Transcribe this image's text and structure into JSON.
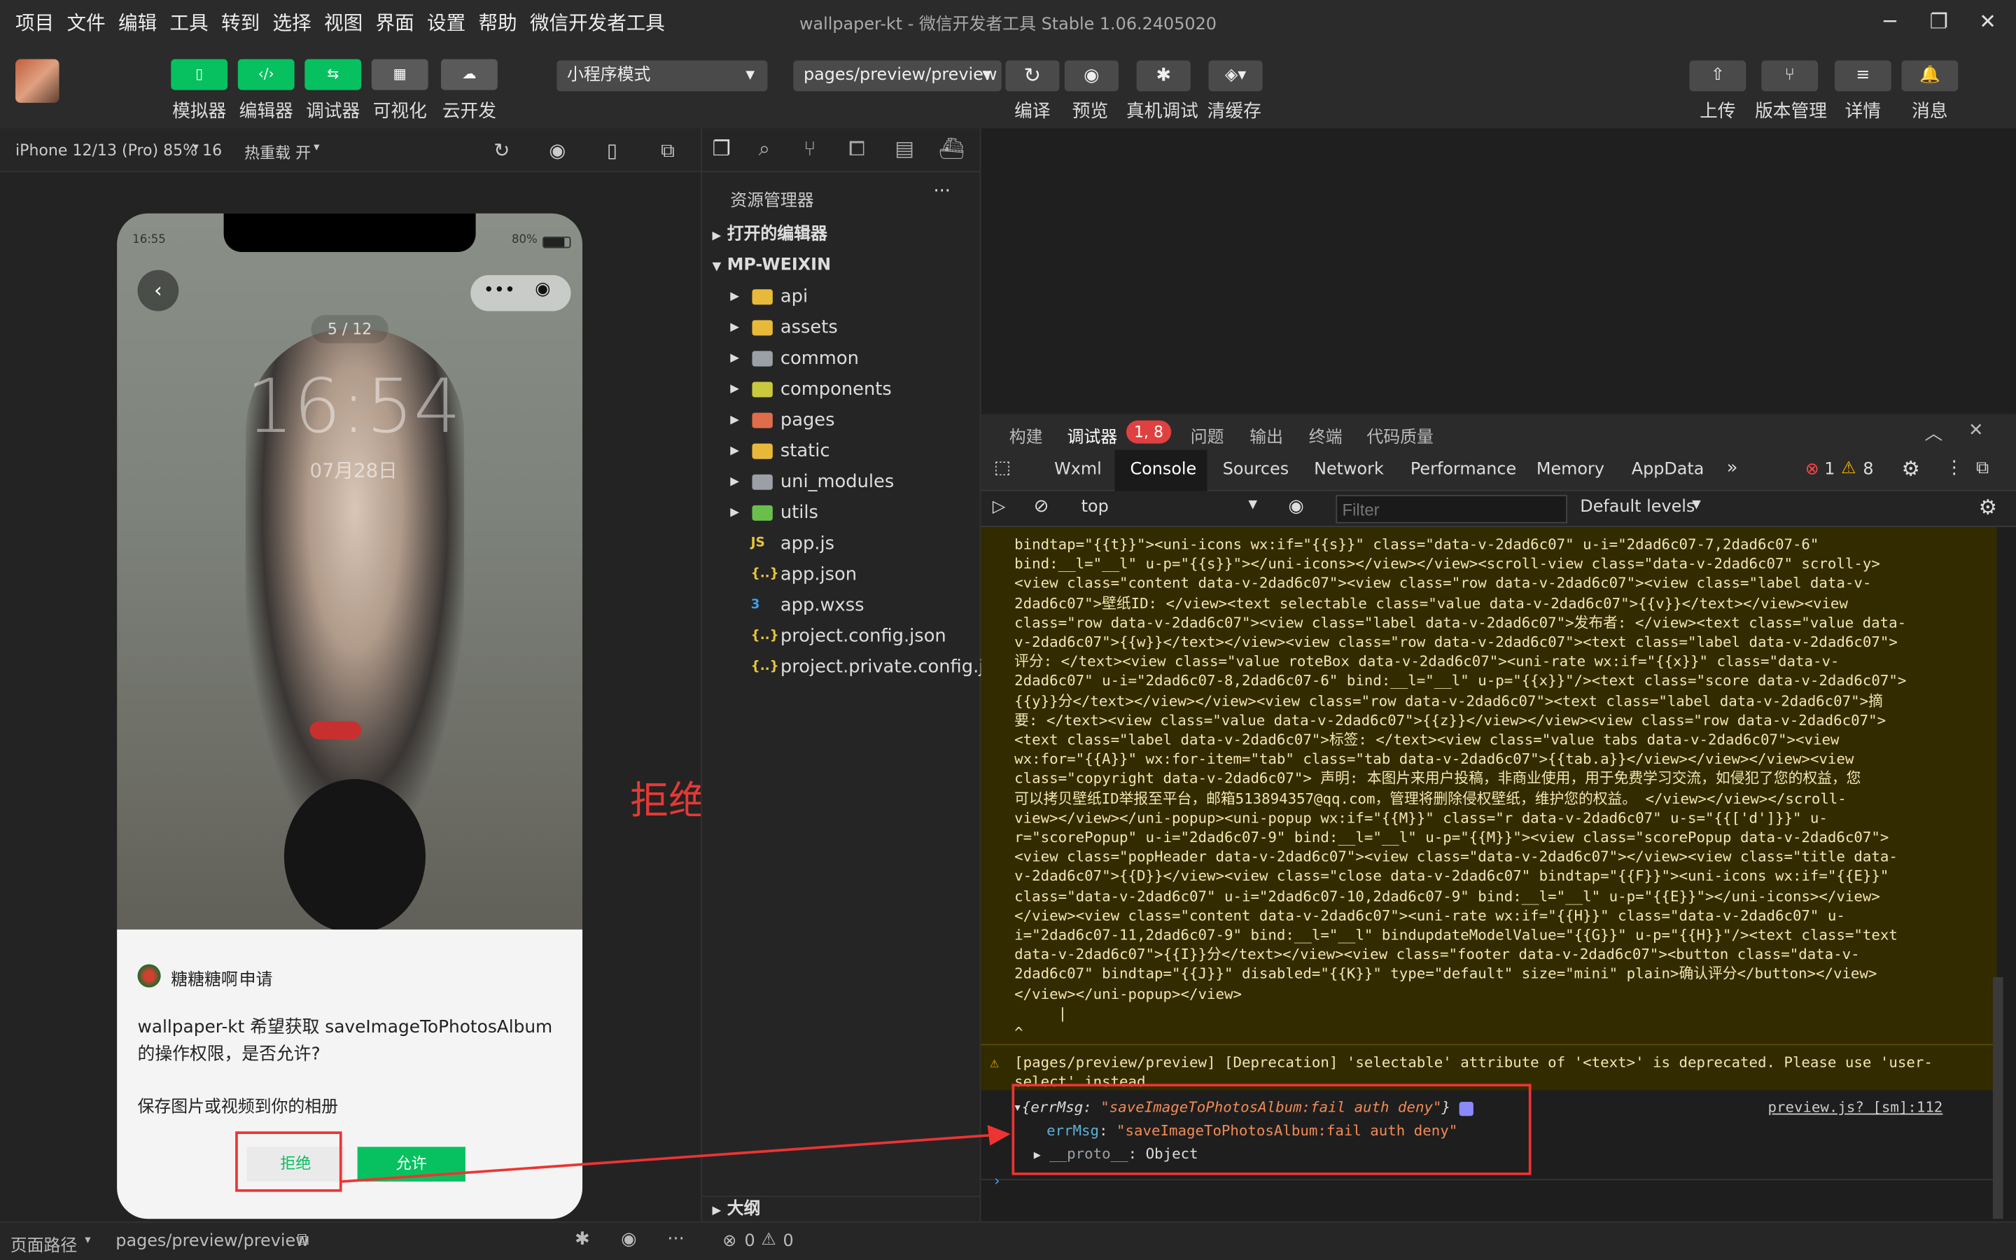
{
  "menu": [
    "项目",
    "文件",
    "编辑",
    "工具",
    "转到",
    "选择",
    "视图",
    "界面",
    "设置",
    "帮助",
    "微信开发者工具"
  ],
  "window_title": "wallpaper-kt - 微信开发者工具 Stable 1.06.2405020",
  "toolbar": {
    "left_buttons": [
      "模拟器",
      "编辑器",
      "调试器",
      "可视化",
      "云开发"
    ],
    "mode": "小程序模式",
    "page_path": "pages/preview/preview",
    "center_buttons": [
      "编译",
      "预览",
      "真机调试",
      "清缓存"
    ],
    "right_buttons": [
      "上传",
      "版本管理",
      "详情",
      "消息"
    ]
  },
  "sim": {
    "device": "iPhone 12/13 (Pro) 85% 16",
    "hot_reload": "热重载 开",
    "status_time": "16:55",
    "battery": "80%",
    "counter": "5 / 12",
    "clock": "16:54",
    "date": "07月28日",
    "dialog": {
      "app_name": "糖糖糖啊",
      "apply": "申请",
      "message": "wallpaper-kt 希望获取 saveImageToPhotosAlbum 的操作权限，是否允许?",
      "detail": "保存图片或视频到你的相册",
      "deny": "拒绝",
      "allow": "允许"
    }
  },
  "annotation": "拒绝授权信息",
  "explorer": {
    "header": "资源管理器",
    "open_editors": "打开的编辑器",
    "root": "MP-WEIXIN",
    "folders": [
      {
        "name": "api",
        "color": "#e8b83a"
      },
      {
        "name": "assets",
        "color": "#e8b83a"
      },
      {
        "name": "common",
        "color": "#9aa0a6"
      },
      {
        "name": "components",
        "color": "#c9c83e"
      },
      {
        "name": "pages",
        "color": "#e06c4c"
      },
      {
        "name": "static",
        "color": "#e8b83a"
      },
      {
        "name": "uni_modules",
        "color": "#9aa0a6"
      },
      {
        "name": "utils",
        "color": "#6abf4b"
      }
    ],
    "files": [
      {
        "name": "app.js",
        "icon": "JS",
        "color": "#e8c63a"
      },
      {
        "name": "app.json",
        "icon": "{..}",
        "color": "#e8c63a"
      },
      {
        "name": "app.wxss",
        "icon": "3",
        "color": "#3aa0e8"
      },
      {
        "name": "project.config.json",
        "icon": "{..}",
        "color": "#e8c63a"
      },
      {
        "name": "project.private.config.js...",
        "icon": "{..}",
        "color": "#e8c63a"
      }
    ],
    "outline": "大纲"
  },
  "devtools": {
    "top_tabs": [
      "构建",
      "调试器",
      "问题",
      "输出",
      "终端",
      "代码质量"
    ],
    "badge": "1, 8",
    "tabs": [
      "Wxml",
      "Console",
      "Sources",
      "Network",
      "Performance",
      "Memory",
      "AppData"
    ],
    "errors": "1",
    "warnings": "8",
    "context": "top",
    "filter_placeholder": "Filter",
    "levels": "Default levels"
  },
  "console": {
    "code_lines": [
      "bindtap=\"{{t}}\"><uni-icons wx:if=\"{{s}}\" class=\"data-v-2dad6c07\" u-i=\"2dad6c07-7,2dad6c07-6\"",
      "bind:__l=\"__l\" u-p=\"{{s}}\"></uni-icons></view></view><scroll-view class=\"data-v-2dad6c07\" scroll-y>",
      "<view class=\"content data-v-2dad6c07\"><view class=\"row data-v-2dad6c07\"><view class=\"label data-v-",
      "2dad6c07\">壁纸ID: </view><text selectable class=\"value data-v-2dad6c07\">{{v}}</text></view><view",
      "class=\"row data-v-2dad6c07\"><view class=\"label data-v-2dad6c07\">发布者: </view><text class=\"value data-",
      "v-2dad6c07\">{{w}}</text></view><view class=\"row data-v-2dad6c07\"><text class=\"label data-v-2dad6c07\">",
      "评分: </text><view class=\"value roteBox data-v-2dad6c07\"><uni-rate wx:if=\"{{x}}\" class=\"data-v-",
      "2dad6c07\" u-i=\"2dad6c07-8,2dad6c07-6\" bind:__l=\"__l\" u-p=\"{{x}}\"/><text class=\"score data-v-2dad6c07\">",
      "{{y}}分</text></view></view><view class=\"row data-v-2dad6c07\"><text class=\"label data-v-2dad6c07\">摘",
      "要: </text><view class=\"value data-v-2dad6c07\">{{z}}</view></view><view class=\"row data-v-2dad6c07\">",
      "<text class=\"label data-v-2dad6c07\">标签: </text><view class=\"value tabs data-v-2dad6c07\"><view",
      "wx:for=\"{{A}}\" wx:for-item=\"tab\" class=\"tab data-v-2dad6c07\">{{tab.a}}</view></view></view><view",
      "class=\"copyright data-v-2dad6c07\"> 声明: 本图片来用户投稿，非商业使用，用于免费学习交流，如侵犯了您的权益，您",
      "可以拷贝壁纸ID举报至平台，邮箱513894357@qq.com，管理将删除侵权壁纸，维护您的权益。 </view></view></scroll-",
      "view></view></uni-popup><uni-popup wx:if=\"{{M}}\" class=\"r data-v-2dad6c07\" u-s=\"{{['d']}}\" u-",
      "r=\"scorePopup\" u-i=\"2dad6c07-9\" bind:__l=\"__l\" u-p=\"{{M}}\"><view class=\"scorePopup data-v-2dad6c07\">",
      "<view class=\"popHeader data-v-2dad6c07\"><view class=\"data-v-2dad6c07\"></view><view class=\"title data-",
      "v-2dad6c07\">{{D}}</view><view class=\"close data-v-2dad6c07\" bindtap=\"{{F}}\"><uni-icons wx:if=\"{{E}}\"",
      "class=\"data-v-2dad6c07\" u-i=\"2dad6c07-10,2dad6c07-9\" bind:__l=\"__l\" u-p=\"{{E}}\"></uni-icons></view>",
      "</view><view class=\"content data-v-2dad6c07\"><uni-rate wx:if=\"{{H}}\" class=\"data-v-2dad6c07\" u-",
      "i=\"2dad6c07-11,2dad6c07-9\" bind:__l=\"__l\" bindupdateModelValue=\"{{G}}\" u-p=\"{{H}}\"/><text class=\"text",
      "data-v-2dad6c07\">{{I}}分</text></view><view class=\"footer data-v-2dad6c07\"><button class=\"data-v-",
      "2dad6c07\" bindtap=\"{{J}}\" disabled=\"{{K}}\" type=\"default\" size=\"mini\" plain>确认评分</button></view>",
      "</view></uni-popup></view>",
      "     |",
      "^"
    ],
    "deprecation": "[pages/preview/preview] [Deprecation] 'selectable' attribute of '<text>' is deprecated. Please use 'user-select' instead.",
    "obj_summary_key": "errMsg",
    "obj_summary_val": "\"saveImageToPhotosAlbum:fail auth deny\"",
    "prop_key": "errMsg",
    "prop_val": "\"saveImageToPhotosAlbum:fail auth deny\"",
    "proto_key": "__proto__",
    "proto_val": "Object",
    "source_link": "preview.js? [sm]:112"
  },
  "statusbar": {
    "path_label": "页面路径",
    "path": "pages/preview/preview",
    "errors": "0",
    "warnings": "0"
  }
}
